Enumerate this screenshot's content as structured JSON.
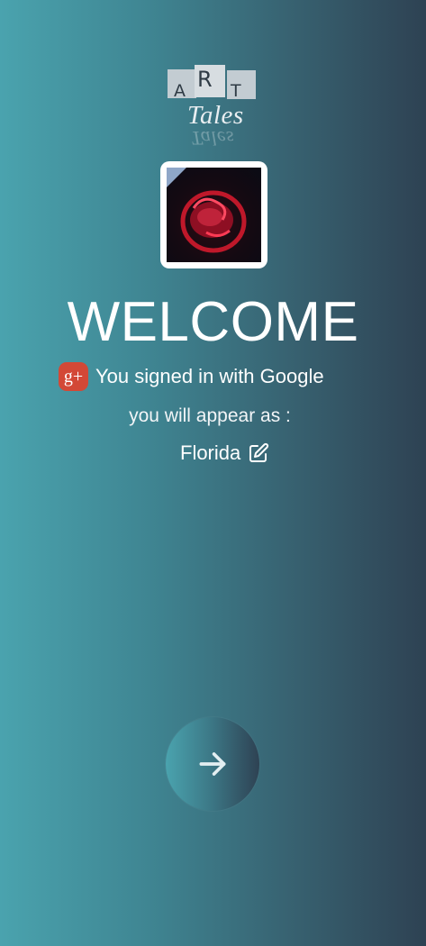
{
  "logo": {
    "letters": [
      "A",
      "R",
      "T"
    ],
    "word": "Tales",
    "reflection": "Tales"
  },
  "avatar": {
    "icon": "scorpion-profile-image"
  },
  "welcome": {
    "title": "WELCOME"
  },
  "signin": {
    "icon": "google-plus-icon",
    "icon_glyph": "g+",
    "text": "You signed in with Google",
    "brand_color": "#d34836"
  },
  "appear": {
    "text": "you will appear as :"
  },
  "user": {
    "name": "Florida",
    "edit_icon": "edit-icon"
  },
  "next": {
    "icon": "arrow-right-icon"
  },
  "colors": {
    "gradient_start": "#4aa3ae",
    "gradient_end": "#2e4253",
    "text": "#ffffff"
  }
}
